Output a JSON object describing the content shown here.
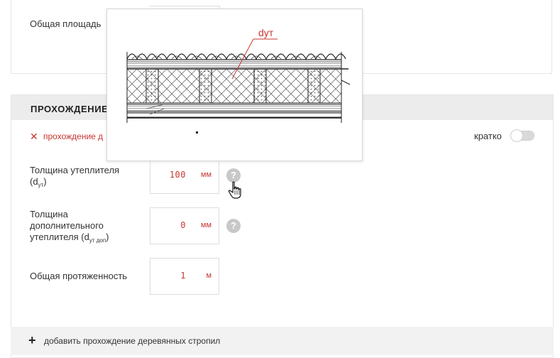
{
  "top_panel": {
    "total_area_label": "Общая площадь"
  },
  "section": {
    "title": "ПРОХОЖДЕНИЕ",
    "remove_label": "прохождение д",
    "brief_label": "кратко",
    "brief_toggle_on": false
  },
  "fields": [
    {
      "label_main": "Толщина утеплителя",
      "label_paren": "(d",
      "label_sub": "ут",
      "label_close": ")",
      "value": "100",
      "unit": "мм"
    },
    {
      "label_line1": "Толщина",
      "label_line2": "дополнительного",
      "label_line3": "утеплителя (d",
      "label_sub": "ут доп",
      "label_close": ")",
      "value": "0",
      "unit": "мм"
    },
    {
      "label_main": "Общая протяженность",
      "value": "1",
      "unit": "м"
    }
  ],
  "help_glyph": "?",
  "add_action": {
    "plus": "+",
    "label": "добавить прохождение деревянных стропил"
  },
  "popup": {
    "diagram_label": "dут",
    "accent_color": "#c8362f"
  },
  "colors": {
    "accent": "#c8362f",
    "section_header_bg": "#ececec",
    "add_bar_bg": "#f2f2f2"
  },
  "icons": {
    "remove": "x-icon",
    "help": "question-icon",
    "cursor": "hand-pointer-icon"
  }
}
